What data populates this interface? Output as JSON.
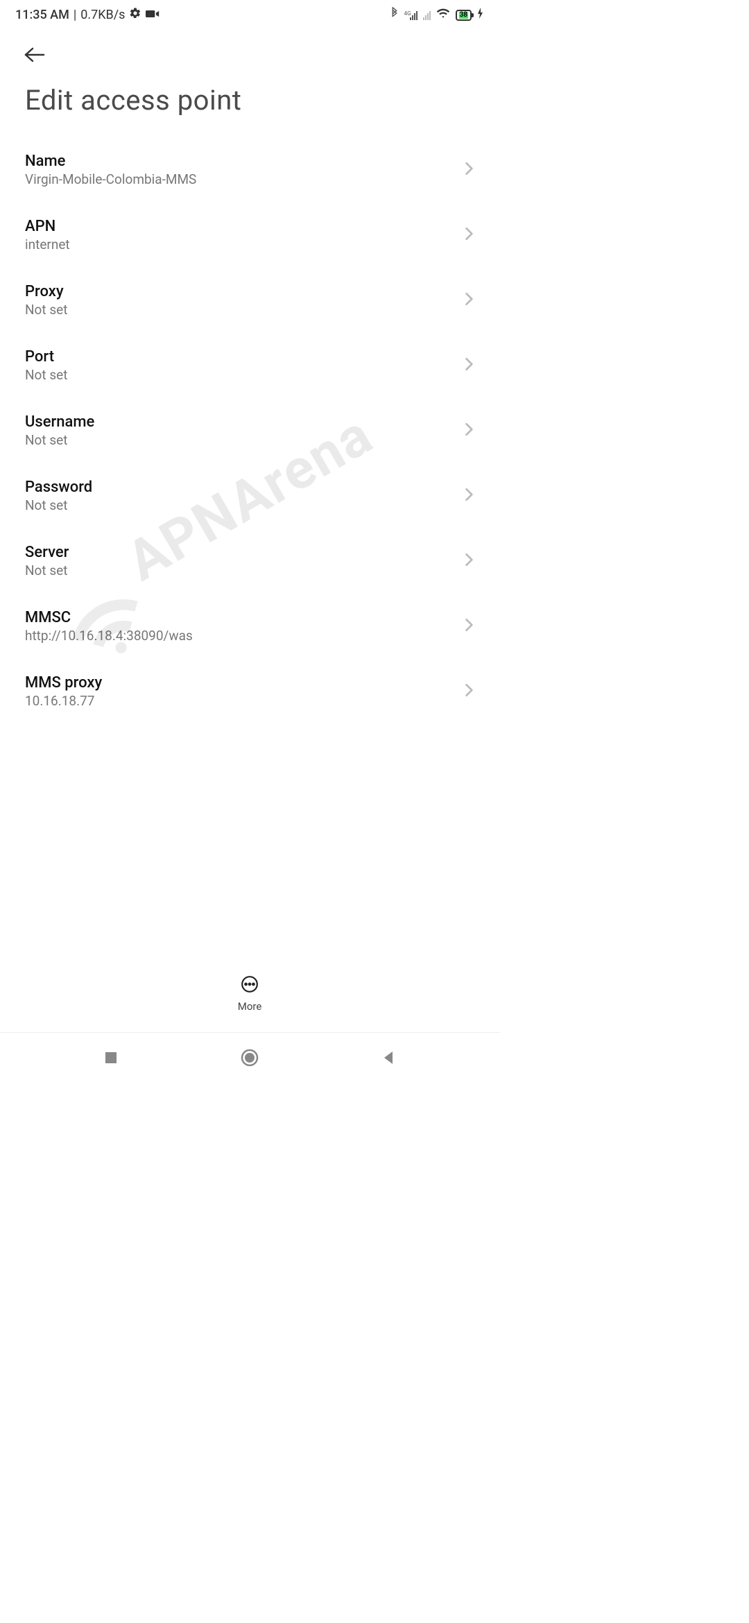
{
  "status": {
    "time": "11:35 AM",
    "rate": "0.7KB/s",
    "battery": "38",
    "network_tag": "4G"
  },
  "header": {
    "title": "Edit access point"
  },
  "settings": [
    {
      "key": "name",
      "label": "Name",
      "value": "Virgin-Mobile-Colombia-MMS"
    },
    {
      "key": "apn",
      "label": "APN",
      "value": "internet"
    },
    {
      "key": "proxy",
      "label": "Proxy",
      "value": "Not set"
    },
    {
      "key": "port",
      "label": "Port",
      "value": "Not set"
    },
    {
      "key": "username",
      "label": "Username",
      "value": "Not set"
    },
    {
      "key": "password",
      "label": "Password",
      "value": "Not set"
    },
    {
      "key": "server",
      "label": "Server",
      "value": "Not set"
    },
    {
      "key": "mmsc",
      "label": "MMSC",
      "value": "http://10.16.18.4:38090/was"
    },
    {
      "key": "mmsproxy",
      "label": "MMS proxy",
      "value": "10.16.18.77"
    }
  ],
  "action": {
    "more": "More"
  },
  "watermark": "APNArena"
}
